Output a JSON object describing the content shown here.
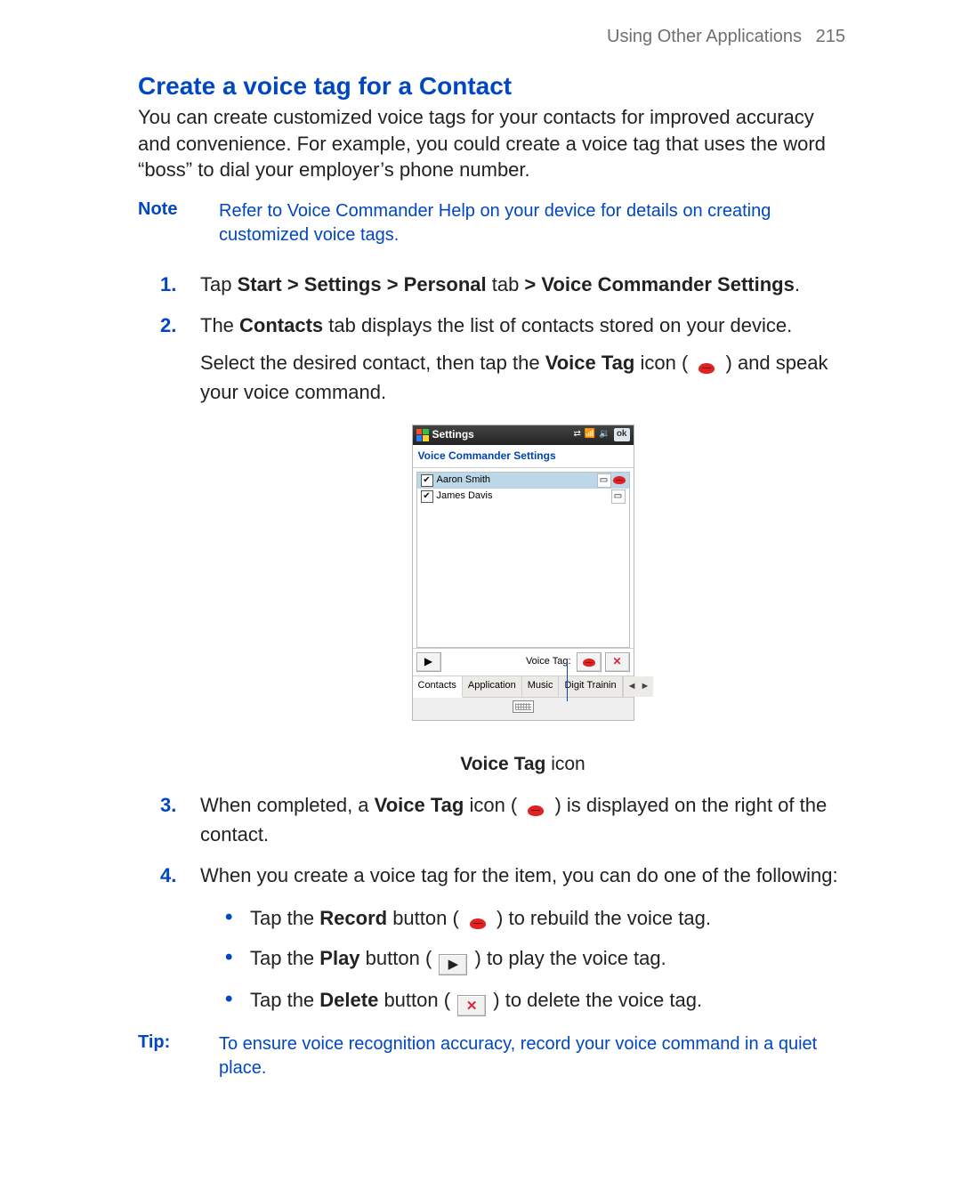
{
  "header": {
    "section": "Using Other Applications",
    "page": "215"
  },
  "title": "Create a voice tag for a Contact",
  "intro": "You can create customized voice tags for your contacts for improved accuracy and convenience.  For  example, you could create a voice tag that uses the word “boss” to dial your employer’s phone number.",
  "note": {
    "label": "Note",
    "body": "Refer to  Voice Commander Help on your device for details on creating customized voice tags."
  },
  "steps": {
    "s1": {
      "tap": "Tap ",
      "path1": "Start",
      "sep1": " > ",
      "path2": "Settings",
      "sep2": " > ",
      "path3": "Personal",
      "mid": " tab ",
      "sep3": "> ",
      "path4": "Voice Commander Settings",
      "end": "."
    },
    "s2": {
      "line1a": "The ",
      "line1b": "Contacts",
      "line1c": " tab displays the list of contacts stored on your device.",
      "line2a": "Select the desired contact, then tap the ",
      "line2b": "Voice Tag",
      "line2c": " icon ( ",
      "line2d": " ) and speak your voice command."
    },
    "s3": {
      "a": "When completed, a ",
      "b": "Voice Tag",
      "c": " icon ( ",
      "d": " ) is displayed on the right of the contact."
    },
    "s4": {
      "lead": "When you create a voice tag for the item, you can do one of the following:",
      "r": {
        "a": "Tap the ",
        "b": "Record",
        "c": " button ( ",
        "d": " ) to rebuild the voice tag."
      },
      "p": {
        "a": "Tap the ",
        "b": "Play",
        "c": " button ( ",
        "d": " ) to play the voice tag."
      },
      "x": {
        "a": "Tap the ",
        "b": "Delete",
        "c": " button ( ",
        "d": " ) to delete the voice tag."
      }
    }
  },
  "caption": {
    "a": "Voice Tag",
    "b": " icon"
  },
  "tip": {
    "label": "Tip:",
    "body": "To ensure voice recognition accuracy, record your voice command in a quiet place."
  },
  "device": {
    "title": "Settings",
    "ok": "ok",
    "subtitle": "Voice Commander Settings",
    "contacts": [
      "Aaron Smith",
      "James Davis"
    ],
    "voiceTagLabel": "Voice Tag:",
    "tabs": [
      "Contacts",
      "Application",
      "Music",
      "Digit Trainin"
    ]
  }
}
